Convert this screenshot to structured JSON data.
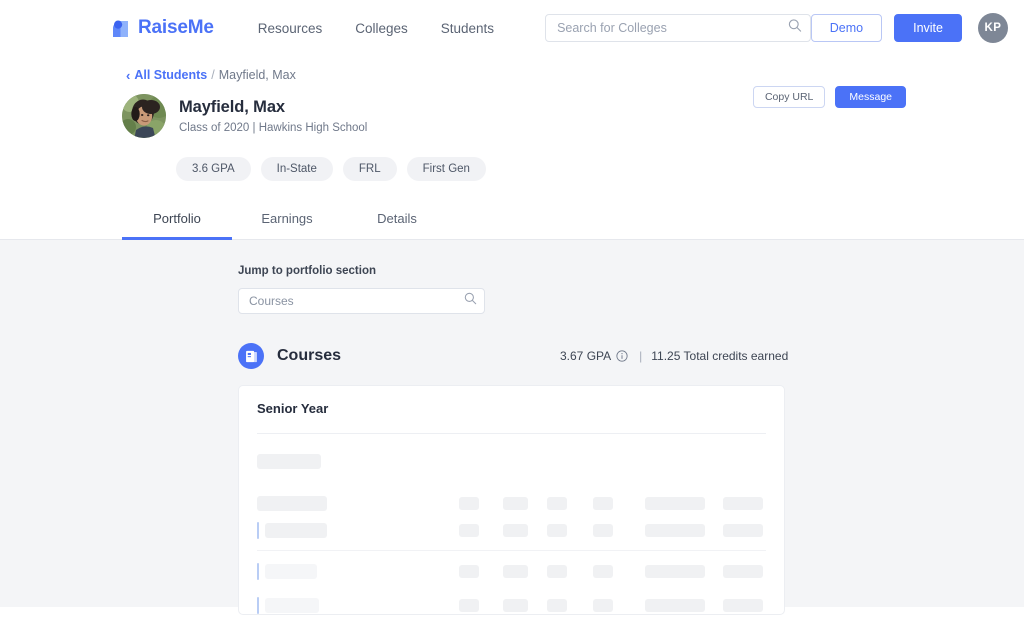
{
  "nav": {
    "brand": "RaiseMe",
    "brand_color": "#4b72f7",
    "links": [
      {
        "label": "Resources"
      },
      {
        "label": "Colleges"
      },
      {
        "label": "Students"
      }
    ],
    "search": {
      "placeholder": "Search for Colleges",
      "value": "",
      "icon": "search-icon"
    },
    "demo_label": "Demo",
    "invite_label": "Invite",
    "avatar_initials": "KP"
  },
  "breadcrumb": {
    "chevron": "‹",
    "root_label": "All Students",
    "separator": "/",
    "current_label": "Mayfield, Max"
  },
  "profile": {
    "name": "Mayfield, Max",
    "subtitle": "Class of 2020  |  Hawkins High School",
    "copy_url_label": "Copy URL",
    "message_label": "Message",
    "chips": [
      {
        "label": "3.6 GPA"
      },
      {
        "label": "In-State"
      },
      {
        "label": "FRL"
      },
      {
        "label": "First Gen"
      }
    ]
  },
  "tabs": {
    "active_index": 0,
    "items": [
      {
        "label": "Portfolio"
      },
      {
        "label": "Earnings"
      },
      {
        "label": "Details"
      }
    ]
  },
  "portfolio": {
    "jump_label": "Jump to portfolio section",
    "jump_placeholder": "Courses",
    "jump_value": "",
    "jump_icon": "search-icon",
    "section": {
      "icon": "book-icon",
      "title": "Courses",
      "gpa_text": "3.67 GPA",
      "info_icon": "info-circle-icon",
      "divider": "|",
      "credits_text": "11.25 Total credits earned"
    },
    "card": {
      "title": "Senior Year",
      "loading": true
    }
  },
  "colors": {
    "accent": "#4b72f7",
    "page_bg": "#f4f5f7",
    "text_primary": "#262d3d",
    "text_muted": "#70798a",
    "chip_bg": "#f1f2f5",
    "skeleton": "#f0f1f3"
  }
}
